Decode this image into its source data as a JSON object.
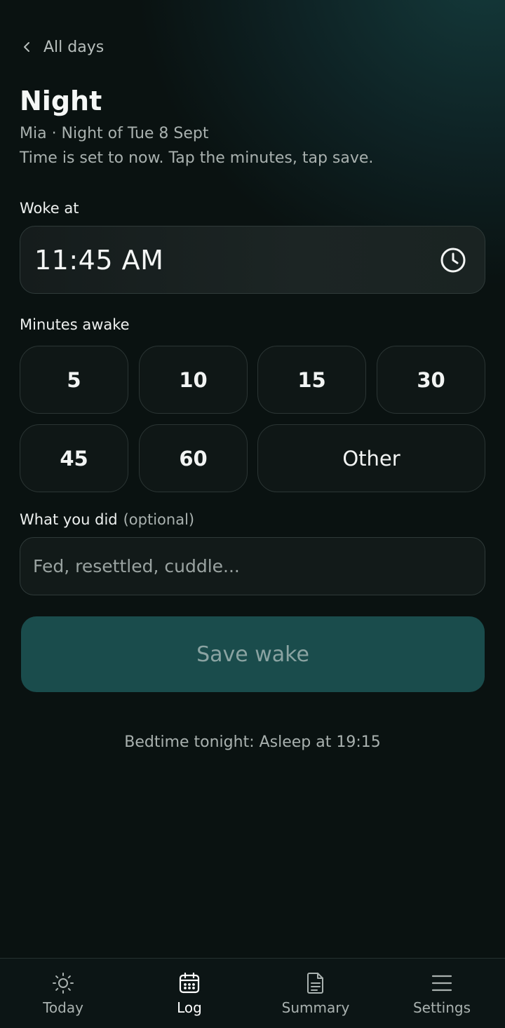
{
  "header": {
    "back_label": "All days",
    "title": "Night",
    "subtitle": "Mia · Night of Tue 8 Sept",
    "hint": "Time is set to now. Tap the minutes, tap save."
  },
  "woke_at": {
    "label": "Woke at",
    "value": "11:45 AM",
    "icon": "clock-icon"
  },
  "minutes_awake": {
    "label": "Minutes awake",
    "options": [
      "5",
      "10",
      "15",
      "30",
      "45",
      "60",
      "Other"
    ]
  },
  "notes": {
    "label": "What you did",
    "optional": "(optional)",
    "placeholder": "Fed, resettled, cuddle..."
  },
  "save_label": "Save wake",
  "bedtime_text": "Bedtime tonight: Asleep at 19:15",
  "nav": {
    "active": "Log",
    "items": [
      {
        "label": "Today",
        "icon": "sun-icon"
      },
      {
        "label": "Log",
        "icon": "calendar-icon"
      },
      {
        "label": "Summary",
        "icon": "document-icon"
      },
      {
        "label": "Settings",
        "icon": "menu-icon"
      }
    ]
  },
  "colors": {
    "background": "#0a1211",
    "accent": "#1a4c4c",
    "text": "#f2f4f3",
    "muted": "#a9b1af"
  }
}
